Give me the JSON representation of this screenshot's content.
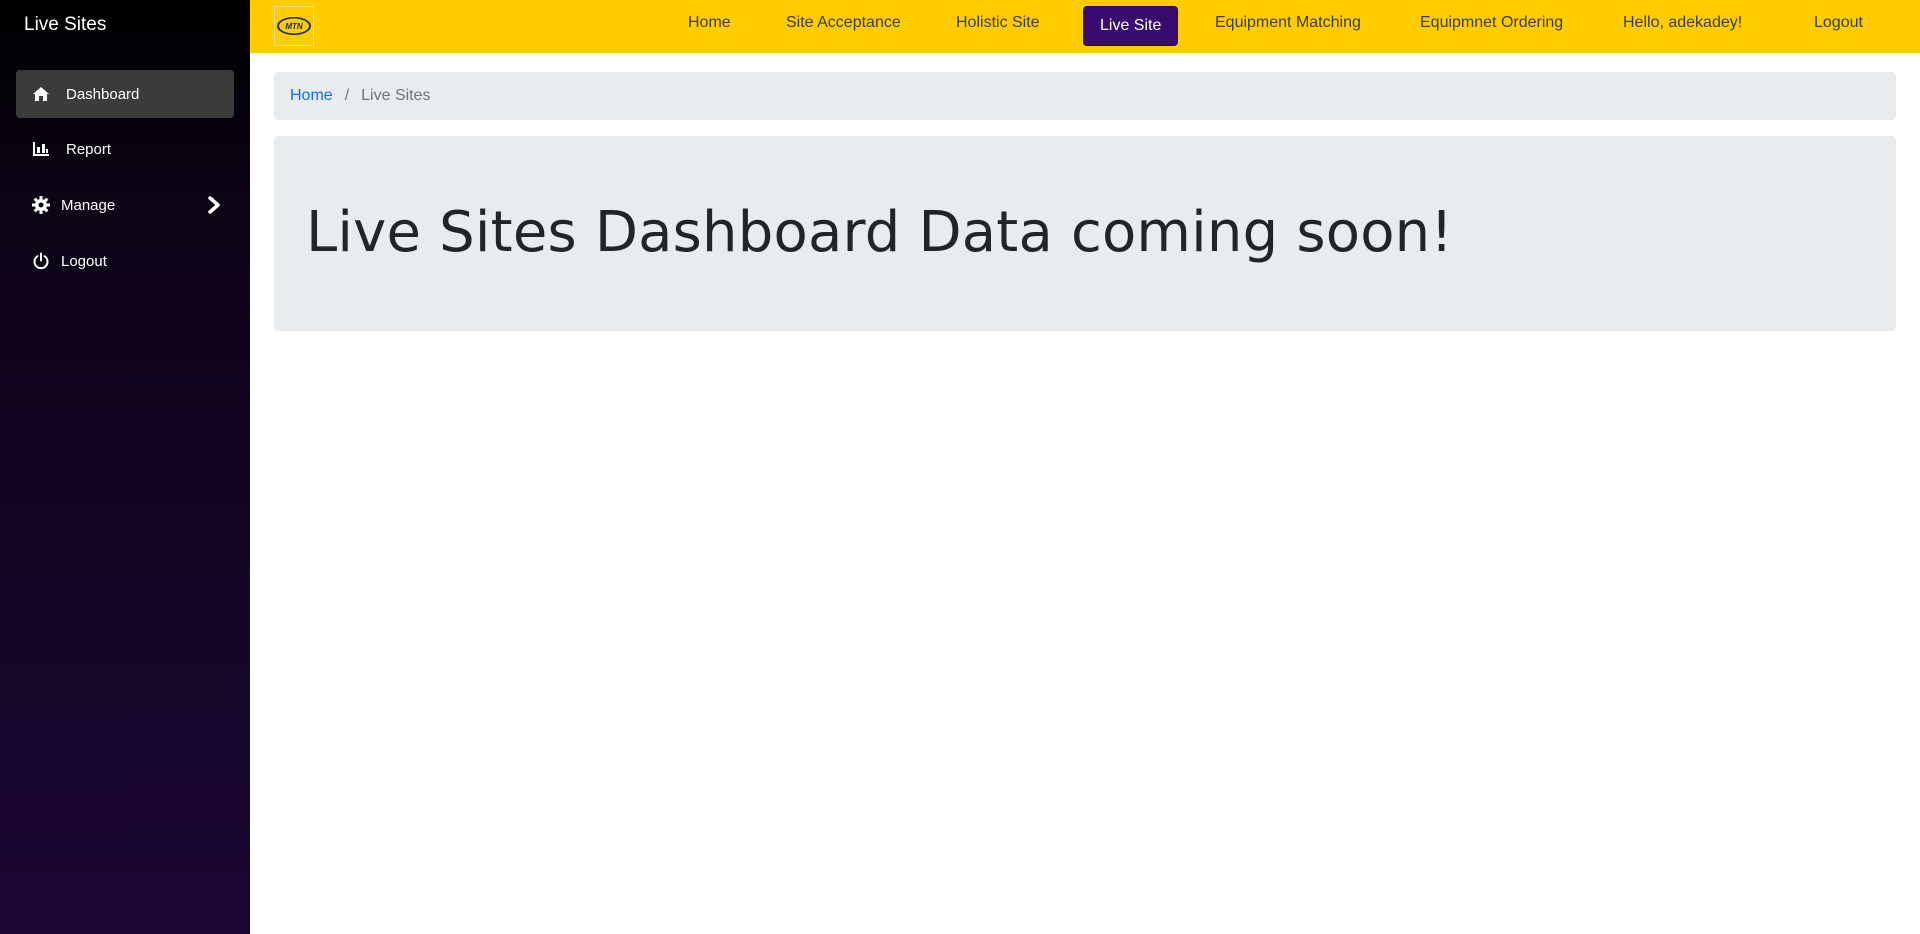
{
  "sidebar": {
    "title": "Live Sites",
    "items": [
      {
        "label": "Dashboard",
        "icon": "home-icon",
        "active": true
      },
      {
        "label": "Report",
        "icon": "bar-chart-icon"
      },
      {
        "label": "Manage",
        "icon": "gear-icon"
      },
      {
        "label": "Logout",
        "icon": "power-icon"
      }
    ]
  },
  "topbar": {
    "logo_text": "MTN",
    "links": [
      {
        "label": "Home"
      },
      {
        "label": "Site Acceptance"
      },
      {
        "label": "Holistic Site"
      },
      {
        "label": "Live Site",
        "active": true
      },
      {
        "label": "Equipment Matching"
      },
      {
        "label": "Equipmnet Ordering"
      },
      {
        "label": "Hello, adekadey!"
      },
      {
        "label": "Logout"
      }
    ]
  },
  "breadcrumb": {
    "home": "Home",
    "separator": "/",
    "current": "Live Sites"
  },
  "main": {
    "heading": "Live Sites Dashboard Data coming soon!"
  },
  "colors": {
    "navbar": "#ffcc00",
    "active_nav": "#3a0b6e",
    "sidebar_bottom": "#1a0733",
    "panel": "#e9ecef",
    "link": "#0d6efd"
  }
}
